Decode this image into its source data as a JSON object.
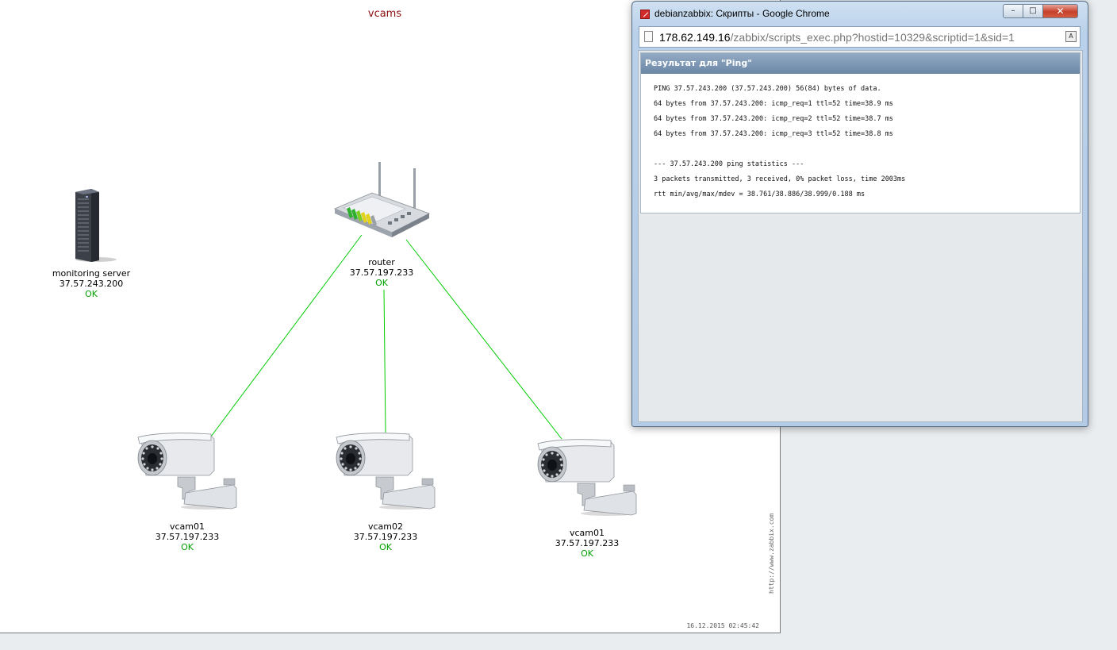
{
  "map": {
    "title": "vcams",
    "timestamp": "16.12.2015 02:45:42",
    "watermark": "http://www.zabbix.com",
    "nodes": {
      "server": {
        "name": "monitoring server",
        "ip": "37.57.243.200",
        "status": "OK",
        "icon": "server-icon"
      },
      "router": {
        "name": "router",
        "ip": "37.57.197.233",
        "status": "OK",
        "icon": "router-icon"
      },
      "cam1": {
        "name": "vcam01",
        "ip": "37.57.197.233",
        "status": "OK",
        "icon": "camera-icon"
      },
      "cam2": {
        "name": "vcam02",
        "ip": "37.57.197.233",
        "status": "OK",
        "icon": "camera-icon"
      },
      "cam3": {
        "name": "vcam01",
        "ip": "37.57.197.233",
        "status": "OK",
        "icon": "camera-icon"
      }
    },
    "link_color": "#00cc00",
    "status_color": "#00a000"
  },
  "window": {
    "title": "debianzabbix: Скрипты - Google Chrome",
    "minimize": "–",
    "maximize": "□",
    "close": "✕",
    "address_host": "178.62.149.16",
    "address_path": "/zabbix/scripts_exec.php?hostid=10329&scriptid=1&sid=1",
    "result_title": "Результат для \"Ping\"",
    "result_lines": [
      "PING 37.57.243.200 (37.57.243.200) 56(84) bytes of data.",
      "64 bytes from 37.57.243.200: icmp_req=1 ttl=52 time=38.9 ms",
      "64 bytes from 37.57.243.200: icmp_req=2 ttl=52 time=38.7 ms",
      "64 bytes from 37.57.243.200: icmp_req=3 ttl=52 time=38.8 ms",
      "",
      "--- 37.57.243.200 ping statistics ---",
      "3 packets transmitted, 3 received, 0% packet loss, time 2003ms",
      "rtt min/avg/max/mdev = 38.761/38.886/38.999/0.188 ms"
    ]
  }
}
